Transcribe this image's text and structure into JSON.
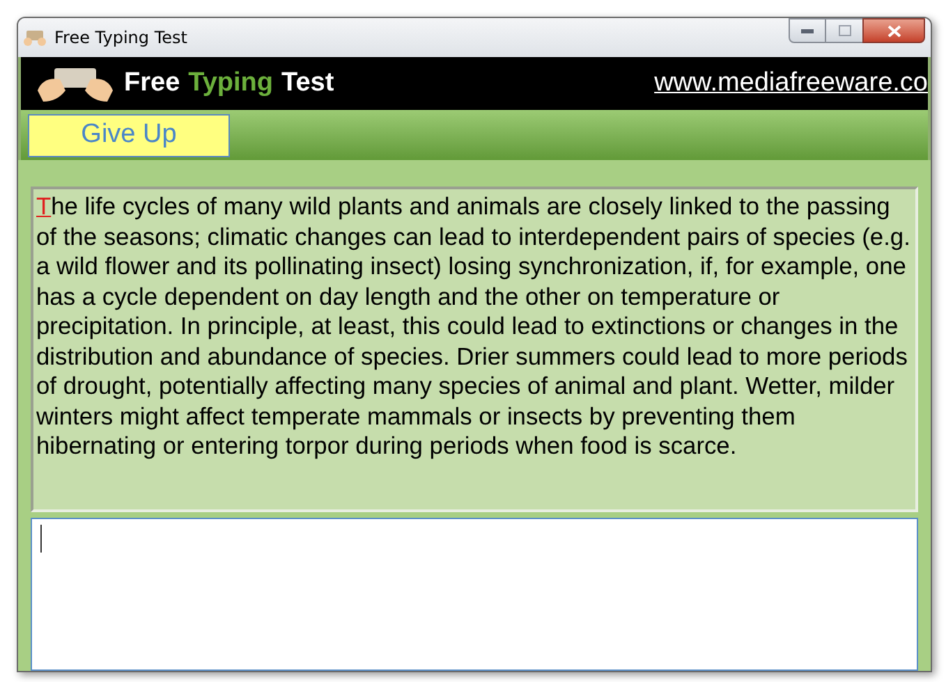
{
  "window": {
    "title": "Free Typing Test"
  },
  "header": {
    "title_parts": [
      {
        "text": "Free",
        "kind": "plain"
      },
      {
        "text": "Typing",
        "kind": "accent"
      },
      {
        "text": "Test",
        "kind": "plain"
      }
    ],
    "website": "www.mediafreeware.co"
  },
  "toolbar": {
    "give_up_button": "Give Up"
  },
  "passage": {
    "current_char": "T",
    "rest": "he life cycles of many wild plants and animals are closely linked to the passing of the seasons; climatic changes can lead to interdependent pairs of species (e.g. a wild flower and its pollinating insect) losing synchronization, if, for example, one has a cycle dependent on day length and the other on temperature or precipitation. In principle, at least, this could lead to extinctions or changes in the distribution and abundance of species. Drier summers could lead to more periods of drought, potentially affecting many species of animal and plant. Wetter, milder winters might affect temperate mammals or insects by preventing them hibernating or entering torpor during periods when food is scarce."
  }
}
